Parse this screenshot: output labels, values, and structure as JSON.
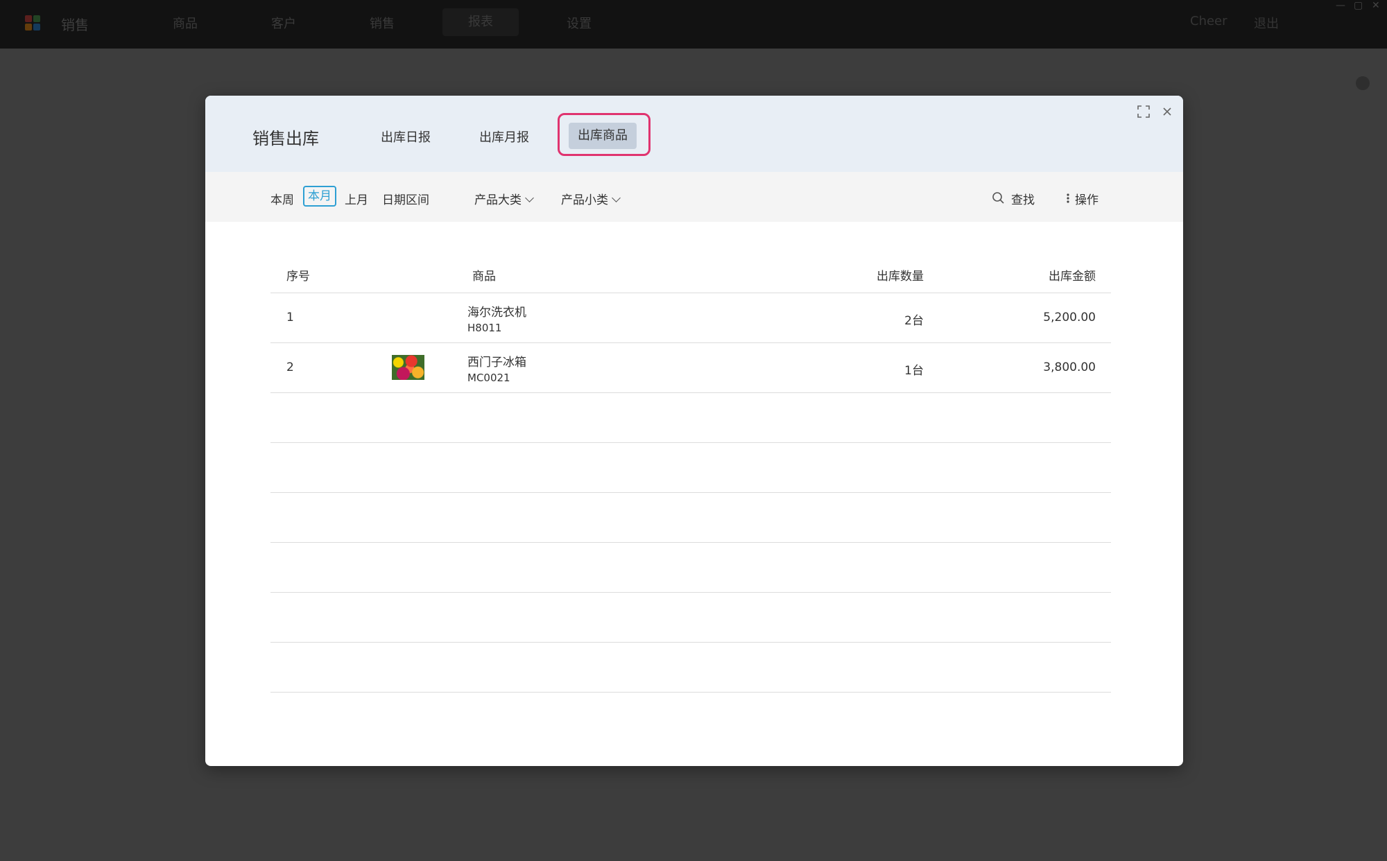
{
  "app": {
    "name": "销售",
    "nav": [
      "商品",
      "客户",
      "销售",
      "报表",
      "设置"
    ],
    "active_nav": "报表",
    "user": "Cheer",
    "logout": "退出"
  },
  "modal": {
    "title": "销售出库",
    "tabs": [
      "出库日报",
      "出库月报",
      "出库商品"
    ],
    "active_tab": "出库商品"
  },
  "filters": {
    "period": [
      "本周",
      "本月",
      "上月",
      "日期区间"
    ],
    "selected_period": "本月",
    "category_major": "产品大类",
    "category_minor": "产品小类",
    "search_label": "查找",
    "actions_label": "操作"
  },
  "table": {
    "columns": [
      "序号",
      "商品",
      "出库数量",
      "出库金额"
    ],
    "rows": [
      {
        "index": "1",
        "name": "海尔洗衣机",
        "code": "H8011",
        "qty": "2台",
        "amount": "5,200.00",
        "has_image": false
      },
      {
        "index": "2",
        "name": "西门子冰箱",
        "code": "MC0021",
        "qty": "1台",
        "amount": "3,800.00",
        "has_image": true
      }
    ],
    "empty_rows": 6
  }
}
